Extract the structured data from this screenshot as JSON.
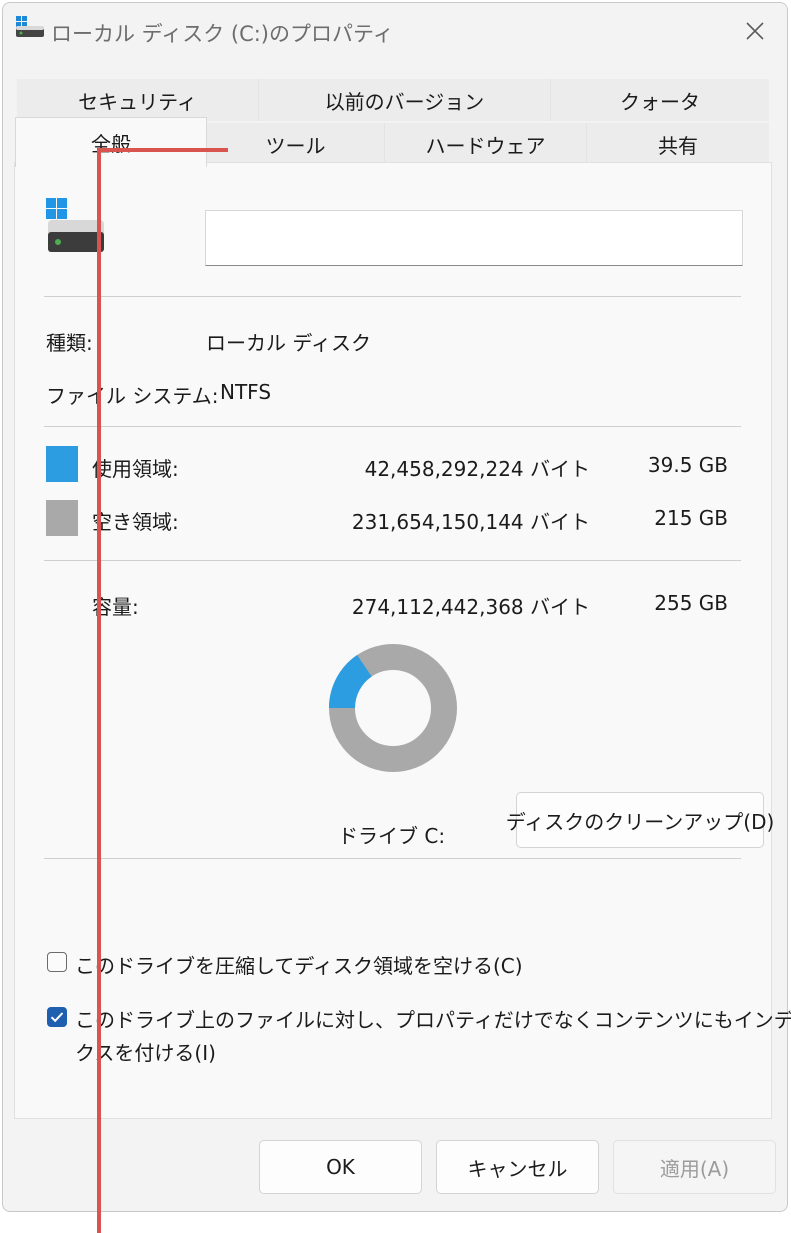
{
  "window": {
    "title": "ローカル ディスク (C:)のプロパティ"
  },
  "tabs_row1": [
    {
      "label": "セキュリティ"
    },
    {
      "label": "以前のバージョン"
    },
    {
      "label": "クォータ"
    }
  ],
  "tabs_row2": [
    {
      "label": "全般",
      "active": true
    },
    {
      "label": "ツール"
    },
    {
      "label": "ハードウェア"
    },
    {
      "label": "共有"
    }
  ],
  "general": {
    "volume_name_value": "",
    "type_label": "種類:",
    "type_value": "ローカル ディスク",
    "fs_label": "ファイル システム:",
    "fs_value": "NTFS",
    "used_label": "使用領域:",
    "used_bytes": "42,458,292,224 バイト",
    "used_size": "39.5 GB",
    "free_label": "空き領域:",
    "free_bytes": "231,654,150,144 バイト",
    "free_size": "215 GB",
    "capacity_label": "容量:",
    "capacity_bytes": "274,112,442,368 バイト",
    "capacity_size": "255 GB",
    "drive_label": "ドライブ C:",
    "cleanup_button": "ディスクのクリーンアップ(D)",
    "compress_label": "このドライブを圧縮してディスク領域を空ける(C)",
    "compress_checked": false,
    "index_label_line1": "このドライブ上のファイルに対し、プロパティだけでなくコンテンツにもインデッ",
    "index_label_line2": "クスを付ける(I)",
    "index_checked": true
  },
  "usage": {
    "used_fraction": 0.155
  },
  "colors": {
    "used": "#2b9de0",
    "free": "#a9a9a9",
    "annotation": "#d9534f"
  },
  "buttons": {
    "ok": "OK",
    "cancel": "キャンセル",
    "apply": "適用(A)"
  },
  "icons": {
    "title": "drive-icon",
    "close": "close-icon",
    "drive": "drive-icon"
  }
}
